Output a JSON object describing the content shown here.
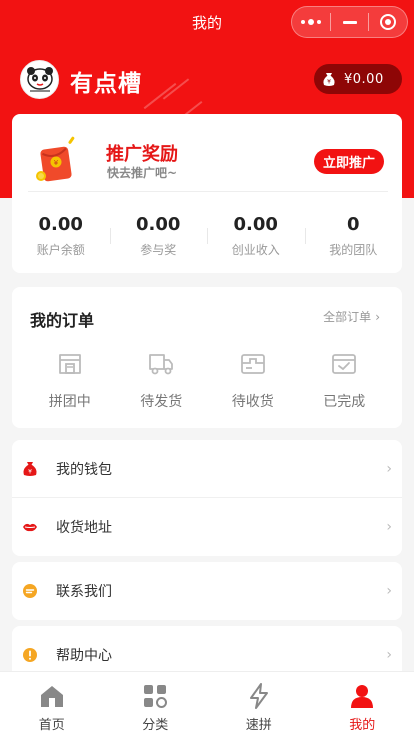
{
  "page_title": "我的",
  "capsule": {
    "more_icon": "more-dots-icon",
    "minimize_icon": "minimize-icon",
    "close_icon": "target-close-icon"
  },
  "profile": {
    "name": "有点槽",
    "avatar_icon": "panda-logo-icon"
  },
  "wallet_pill": {
    "icon": "money-bag-icon",
    "amount": "¥0.00"
  },
  "promo": {
    "title": "推广奖励",
    "subtitle": "快去推广吧~",
    "button": "立即推广",
    "icon": "red-envelope-icon",
    "stats": [
      {
        "value": "0.00",
        "label": "账户余额"
      },
      {
        "value": "0.00",
        "label": "参与奖"
      },
      {
        "value": "0.00",
        "label": "创业收入"
      },
      {
        "value": "0",
        "label": "我的团队"
      }
    ]
  },
  "orders": {
    "title": "我的订单",
    "all_label": "全部订单",
    "items": [
      {
        "label": "拼团中",
        "icon": "shop-icon"
      },
      {
        "label": "待发货",
        "icon": "truck-icon"
      },
      {
        "label": "待收货",
        "icon": "package-icon"
      },
      {
        "label": "已完成",
        "icon": "done-box-icon"
      }
    ]
  },
  "menu": [
    {
      "label": "我的钱包",
      "icon": "wallet-bag-icon"
    },
    {
      "label": "收货地址",
      "icon": "lips-icon"
    },
    {
      "label": "联系我们",
      "icon": "chat-bubble-icon"
    },
    {
      "label": "帮助中心",
      "icon": "help-icon"
    }
  ],
  "tabbar": [
    {
      "label": "首页",
      "icon": "home-icon",
      "active": false
    },
    {
      "label": "分类",
      "icon": "grid-icon",
      "active": false
    },
    {
      "label": "速拼",
      "icon": "lightning-icon",
      "active": false
    },
    {
      "label": "我的",
      "icon": "user-icon",
      "active": true
    }
  ],
  "colors": {
    "brand_red": "#f21212",
    "dark_red": "#8e0606",
    "accent_orange": "#f5a623"
  }
}
